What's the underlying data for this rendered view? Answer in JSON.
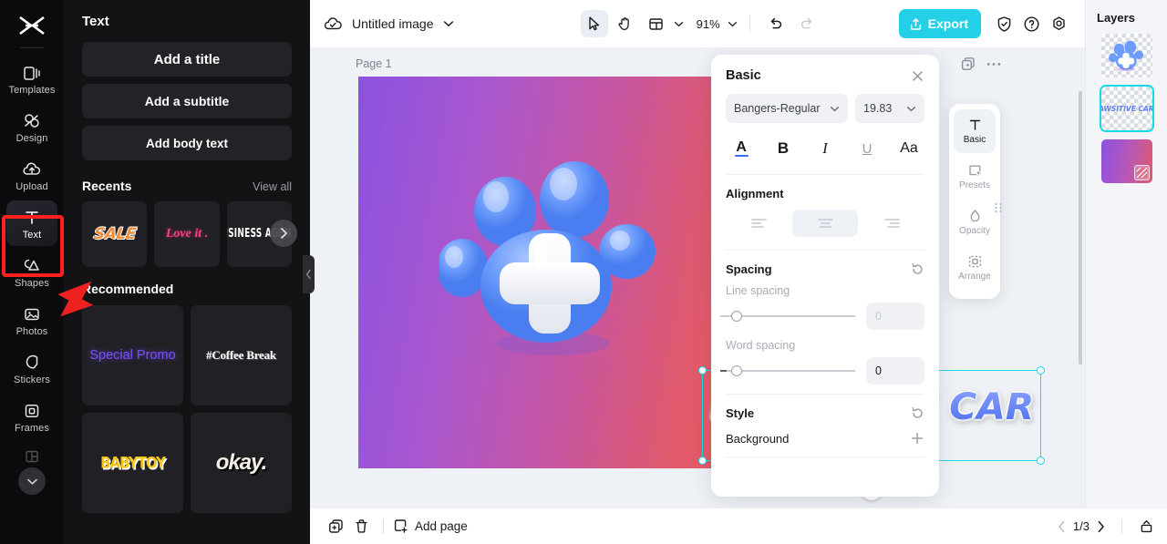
{
  "rail": {
    "logo_icon": "capcut-logo-icon",
    "items": [
      {
        "label": "Templates",
        "icon": "templates-icon",
        "active": false
      },
      {
        "label": "Design",
        "icon": "design-icon",
        "active": false
      },
      {
        "label": "Upload",
        "icon": "upload-cloud-icon",
        "active": false
      },
      {
        "label": "Text",
        "icon": "text-t-icon",
        "active": true
      },
      {
        "label": "Shapes",
        "icon": "shapes-icon",
        "active": false
      },
      {
        "label": "Photos",
        "icon": "photos-image-icon",
        "active": false
      },
      {
        "label": "Stickers",
        "icon": "stickers-icon",
        "active": false
      },
      {
        "label": "Frames",
        "icon": "frames-icon",
        "active": false
      }
    ],
    "expand_icon": "chevron-down-icon"
  },
  "text_panel": {
    "title": "Text",
    "add_title": "Add a title",
    "add_subtitle": "Add a subtitle",
    "add_body": "Add body text",
    "recents_title": "Recents",
    "view_all": "View all",
    "recents": [
      {
        "label": "SALE"
      },
      {
        "label": "Love it ."
      },
      {
        "label": "BUSINESS AGENCY"
      }
    ],
    "next_icon": "chevron-right-icon",
    "recommended_title": "Recommended",
    "recommended": [
      {
        "label": "Special Promo"
      },
      {
        "label": "#Coffee Break"
      },
      {
        "label": "BABYTOY"
      },
      {
        "label": "okay."
      }
    ],
    "collapse_icon": "chevron-left-icon"
  },
  "topbar": {
    "cloud_icon": "cloud-check-icon",
    "doc_title": "Untitled image",
    "title_caret": "chevron-down-icon",
    "select_icon": "cursor-select-icon",
    "hand_icon": "hand-pan-icon",
    "layout_icon": "layout-grid-icon",
    "layout_caret": "chevron-down-icon",
    "zoom": "91%",
    "zoom_caret": "chevron-down-icon",
    "undo_icon": "undo-icon",
    "redo_icon": "redo-icon",
    "export_label": "Export",
    "export_icon": "export-upload-icon",
    "export_color": "#24d0e8",
    "shield_icon": "shield-check-icon",
    "help_icon": "help-circle-icon",
    "settings_icon": "settings-gear-icon"
  },
  "stage": {
    "page_label": "Page 1",
    "duplicate_icon": "duplicate-page-icon",
    "more_icon": "more-dots-icon",
    "canvas_text": "PAWSITIVE CARE",
    "canvas_gradient": [
      "#8b52e0",
      "#c8569f",
      "#ea5a5e"
    ],
    "paw_color": "#6c9bfb",
    "mini_copy_icon": "copy-plus-icon",
    "mini_more_icon": "more-dots-icon",
    "rotate_icon": "rotate-handle-icon",
    "selection_color": "#19d8e8"
  },
  "properties": {
    "title": "Basic",
    "close_icon": "close-x-icon",
    "font_family": "Bangers-Regular",
    "font_caret": "chevron-down-icon",
    "font_size": "19.83",
    "size_caret": "chevron-down-icon",
    "format_buttons": [
      {
        "name": "text-color",
        "glyph": "A"
      },
      {
        "name": "bold",
        "glyph": "B"
      },
      {
        "name": "italic",
        "glyph": "I"
      },
      {
        "name": "underline",
        "glyph": "U"
      },
      {
        "name": "case",
        "glyph": "Aa"
      }
    ],
    "alignment_label": "Alignment",
    "alignment_options": [
      "align-left",
      "align-center",
      "align-right"
    ],
    "alignment_selected": "align-center",
    "spacing_label": "Spacing",
    "spacing_reset_icon": "reset-icon",
    "line_spacing_label": "Line spacing",
    "line_spacing_value": "0",
    "word_spacing_label": "Word spacing",
    "word_spacing_value": "0",
    "style_label": "Style",
    "style_reset_icon": "reset-icon",
    "background_label": "Background",
    "background_add_icon": "plus-icon"
  },
  "tool_tabs": [
    {
      "label": "Basic",
      "icon": "text-t-icon",
      "active": true
    },
    {
      "label": "Presets",
      "icon": "presets-star-icon",
      "active": false
    },
    {
      "label": "Opacity",
      "icon": "opacity-drop-icon",
      "active": false
    },
    {
      "label": "Arrange",
      "icon": "arrange-icon",
      "active": false
    }
  ],
  "layers": {
    "title": "Layers",
    "items": [
      {
        "name": "paw-graphic-layer",
        "type": "image",
        "selected": false
      },
      {
        "name": "pawsitive-care-text-layer",
        "type": "text",
        "label": "PAWSITIVE CARE",
        "selected": true
      },
      {
        "name": "gradient-background-layer",
        "type": "background",
        "selected": false
      }
    ],
    "drag_icon": "drag-dots-icon"
  },
  "bottombar": {
    "duplicate_icon": "duplicate-icon",
    "delete_icon": "trash-icon",
    "add_page_label": "Add page",
    "add_page_icon": "add-page-icon",
    "prev_icon": "chevron-left-icon",
    "page_indicator": "1/3",
    "next_icon": "chevron-right-icon",
    "timeline_icon": "timeline-icon"
  }
}
